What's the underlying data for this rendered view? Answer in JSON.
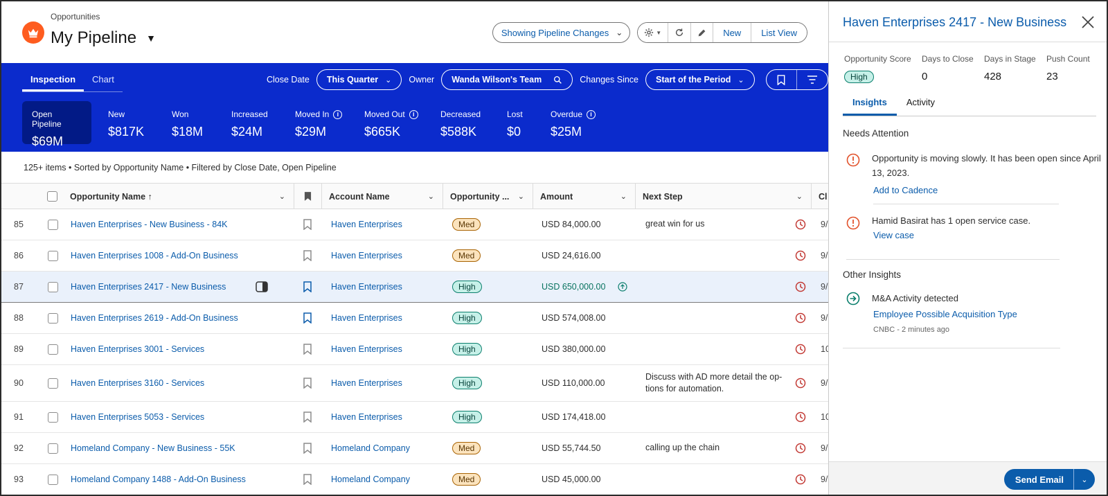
{
  "header": {
    "breadcrumb": "Opportunities",
    "title": "My Pipeline",
    "showing_label": "Showing Pipeline Changes",
    "new_label": "New",
    "listview_label": "List View"
  },
  "band": {
    "tabs": [
      "Inspection",
      "Chart"
    ],
    "close_date_label": "Close Date",
    "close_date_value": "This Quarter",
    "owner_label": "Owner",
    "owner_value": "Wanda Wilson's Team",
    "changes_label": "Changes Since",
    "changes_value": "Start of the Period",
    "metrics": [
      {
        "label": "Open Pipeline",
        "value": "$69M"
      },
      {
        "label": "New",
        "value": "$817K"
      },
      {
        "label": "Won",
        "value": "$18M"
      },
      {
        "label": "Increased",
        "value": "$24M"
      },
      {
        "label": "Moved In",
        "value": "$29M"
      },
      {
        "label": "Moved Out",
        "value": "$665K"
      },
      {
        "label": "Decreased",
        "value": "$588K"
      },
      {
        "label": "Lost",
        "value": "$0"
      },
      {
        "label": "Overdue",
        "value": "$25M"
      }
    ]
  },
  "summary": "125+ items • Sorted by Opportunity Name • Filtered by Close Date, Open Pipeline",
  "table": {
    "columns": {
      "opp_name": "Opportunity Name ↑",
      "account": "Account Name",
      "score": "Opportunity ...",
      "amount": "Amount",
      "next_step": "Next Step",
      "close": "Cl"
    },
    "rows": [
      {
        "num": "85",
        "name": "Haven Enterprises - New Business - 84K",
        "account": "Haven Enterprises",
        "score": "Med",
        "amount": "USD 84,000.00",
        "next": "great win for us",
        "close": "9/"
      },
      {
        "num": "86",
        "name": "Haven Enterprises 1008 - Add-On Business",
        "account": "Haven Enterprises",
        "score": "Med",
        "amount": "USD 24,616.00",
        "next": "",
        "close": "9/"
      },
      {
        "num": "87",
        "name": "Haven Enterprises 2417 - New Business",
        "account": "Haven Enterprises",
        "score": "High",
        "amount": "USD 650,000.00",
        "next": "",
        "close": "9/"
      },
      {
        "num": "88",
        "name": "Haven Enterprises 2619 - Add-On Business",
        "account": "Haven Enterprises",
        "score": "High",
        "amount": "USD 574,008.00",
        "next": "",
        "close": "9/"
      },
      {
        "num": "89",
        "name": "Haven Enterprises 3001 - Services",
        "account": "Haven Enterprises",
        "score": "High",
        "amount": "USD 380,000.00",
        "next": "",
        "close": "10"
      },
      {
        "num": "90",
        "name": "Haven Enterprises 3160 - Services",
        "account": "Haven Enterprises",
        "score": "High",
        "amount": "USD 110,000.00",
        "next": "Discuss with AD more detail the op-tions for automation.",
        "close": "9/"
      },
      {
        "num": "91",
        "name": "Haven Enterprises 5053 - Services",
        "account": "Haven Enterprises",
        "score": "High",
        "amount": "USD 174,418.00",
        "next": "",
        "close": "10"
      },
      {
        "num": "92",
        "name": "Homeland Company - New Business - 55K",
        "account": "Homeland Company",
        "score": "Med",
        "amount": "USD 55,744.50",
        "next": "calling up the chain",
        "close": "9/"
      },
      {
        "num": "93",
        "name": "Homeland Company 1488 - Add-On Business",
        "account": "Homeland Company",
        "score": "Med",
        "amount": "USD 45,000.00",
        "next": "",
        "close": "9/"
      }
    ]
  },
  "panel": {
    "title": "Haven Enterprises 2417 - New Business",
    "stats": [
      {
        "label": "Opportunity Score",
        "value": "High"
      },
      {
        "label": "Days to Close",
        "value": "0"
      },
      {
        "label": "Days in Stage",
        "value": "428"
      },
      {
        "label": "Push Count",
        "value": "23"
      }
    ],
    "tabs": [
      "Insights",
      "Activity"
    ],
    "needs_attention": "Needs Attention",
    "insight1_text": "Opportunity is moving slowly. It has been open since April 13, 2023.",
    "insight1_link": "Add to Cadence",
    "insight2_text": "Hamid Basirat has 1 open service  case.",
    "insight2_link": "View case",
    "other_insights": "Other Insights",
    "insight3_text": "M&A Activity detected",
    "insight3_link": "Employee Possible Acquisition Type",
    "insight3_meta": "CNBC - 2 minutes ago",
    "send_label": "Send Email"
  },
  "colors": {
    "band": "#0b2bcc",
    "link": "#0b5cab",
    "brand": "#fe5c1f",
    "warning": "#e2522b",
    "positive": "#0a7e6c"
  }
}
